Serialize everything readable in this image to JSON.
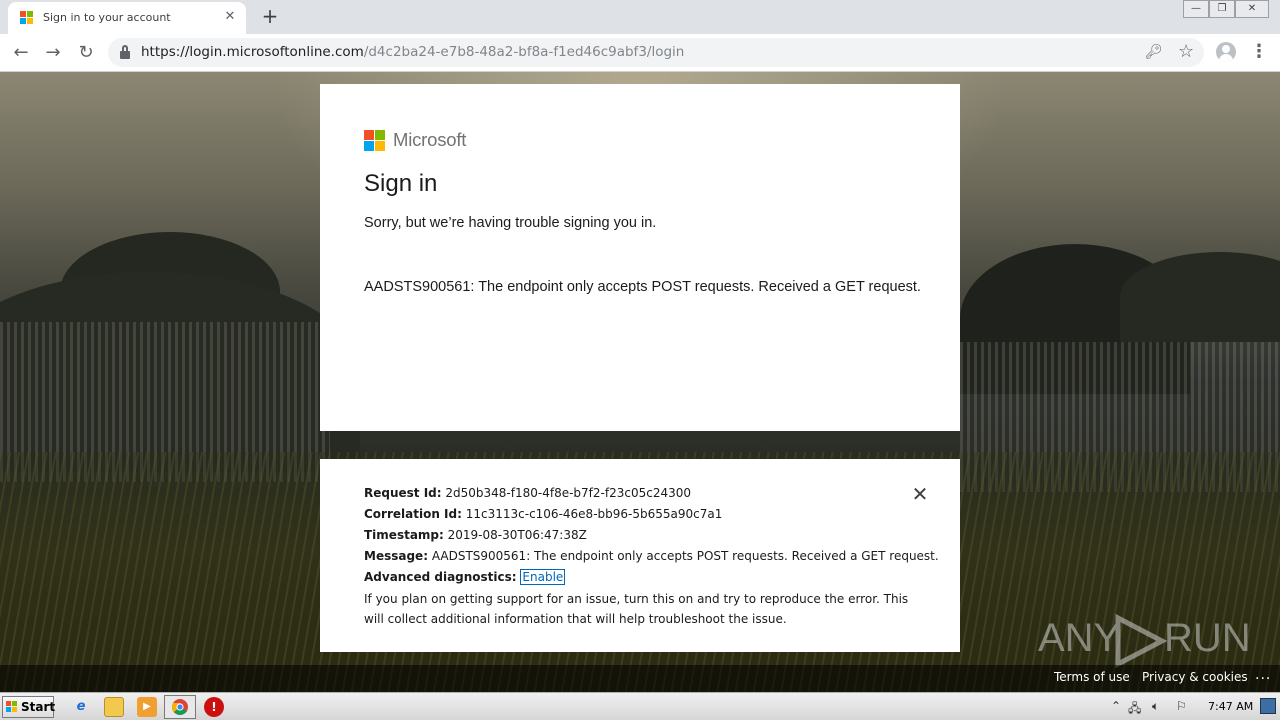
{
  "browser": {
    "tab_title": "Sign in to your account",
    "url_host": "https://login.microsoftonline.com",
    "url_path": "/d4c2ba24-e7b8-48a2-bf8a-f1ed46c9abf3/login",
    "new_tab_label": "+",
    "tab_close_label": "✕"
  },
  "brand": {
    "logo_text": "Microsoft",
    "colors": [
      "#f25022",
      "#7fba00",
      "#00a4ef",
      "#ffb900"
    ]
  },
  "signin": {
    "title": "Sign in",
    "message": "Sorry, but we’re having trouble signing you in.",
    "error": "AADSTS900561: The endpoint only accepts POST requests. Received a GET request."
  },
  "details": {
    "request_id_label": "Request Id:",
    "request_id": "2d50b348-f180-4f8e-b7f2-f23c05c24300",
    "correlation_id_label": "Correlation Id:",
    "correlation_id": "11c3113c-c106-46e8-bb96-5b655a90c7a1",
    "timestamp_label": "Timestamp:",
    "timestamp": "2019-08-30T06:47:38Z",
    "message_label": "Message:",
    "message": "AADSTS900561: The endpoint only accepts POST requests. Received a GET request.",
    "diagnostics_label": "Advanced diagnostics:",
    "enable_link": "Enable",
    "note": "If you plan on getting support for an issue, turn this on and try to reproduce the error. This will collect additional information that will help troubleshoot the issue."
  },
  "footer": {
    "terms": "Terms of use",
    "privacy": "Privacy & cookies",
    "more": "..."
  },
  "watermark": {
    "left": "ANY",
    "right": "RUN"
  },
  "taskbar": {
    "start_label": "Start",
    "clock": "7:47 AM"
  }
}
